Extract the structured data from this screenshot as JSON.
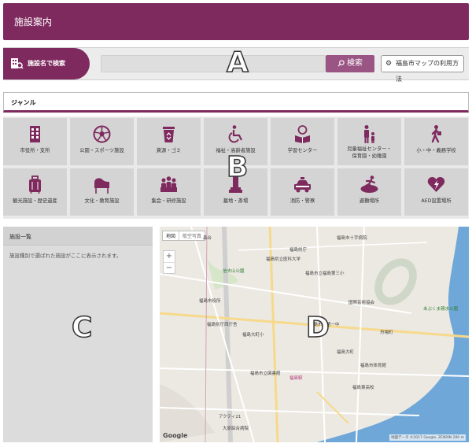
{
  "header": {
    "title": "施設案内"
  },
  "search": {
    "tab_label": "施設名で検索",
    "input_value": "",
    "button_label": "検索",
    "help_label": "福島市マップの利用方法"
  },
  "genre": {
    "label": "ジャンル"
  },
  "categories": [
    {
      "label": "市役所・支所",
      "icon": "city-hall-icon"
    },
    {
      "label": "公園・スポーツ施設",
      "icon": "ball-icon"
    },
    {
      "label": "資源・ゴミ",
      "icon": "recycle-bin-icon"
    },
    {
      "label": "福祉・高齢者施設",
      "icon": "wheelchair-icon"
    },
    {
      "label": "学習センター",
      "icon": "reading-icon"
    },
    {
      "label": "児童福祉センター・\n保育園・幼稚園",
      "icon": "parent-child-icon"
    },
    {
      "label": "小・中・義務学校",
      "icon": "student-icon"
    },
    {
      "label": "観光施設・歴史遺産",
      "icon": "suitcase-icon"
    },
    {
      "label": "文化・教育施設",
      "icon": "piano-icon"
    },
    {
      "label": "集会・研修施設",
      "icon": "people-icon"
    },
    {
      "label": "墓地・斎場",
      "icon": "monument-icon"
    },
    {
      "label": "消防・警察",
      "icon": "police-car-icon"
    },
    {
      "label": "避難場所",
      "icon": "evacuation-icon"
    },
    {
      "label": "AED設置場所",
      "icon": "aed-heart-icon"
    }
  ],
  "panel": {
    "title": "施設一覧",
    "description": "施設種別で選ばれた施設がここに表示されます。"
  },
  "map": {
    "type_map": "地図",
    "type_satellite": "航空写真",
    "zoom_in": "+",
    "zoom_out": "−",
    "labels": [
      "福島市十字病院",
      "福島県庁",
      "福島県立医科大学",
      "信夫山公園",
      "福島市立福島第三小",
      "福島市役所",
      "福島大町小",
      "福島市立第一中",
      "福島大町",
      "福島市立図書館",
      "福島駅",
      "福島県庁西庁舎",
      "福島東高校",
      "アクティ21",
      "大原綜合病院",
      "あぶくま親水公園",
      "国際芸術協会",
      "福島市体育館",
      "森合",
      "舟場町"
    ],
    "google": "Google",
    "copyright": "地図データ ©2017 Google, ZENRIN  200 m"
  },
  "annotations": {
    "a": "A",
    "b": "B",
    "c": "C",
    "d": "D"
  },
  "colors": {
    "brand": "#7e2a5e",
    "button": "#9a5585",
    "icon": "#7e2a5e"
  }
}
